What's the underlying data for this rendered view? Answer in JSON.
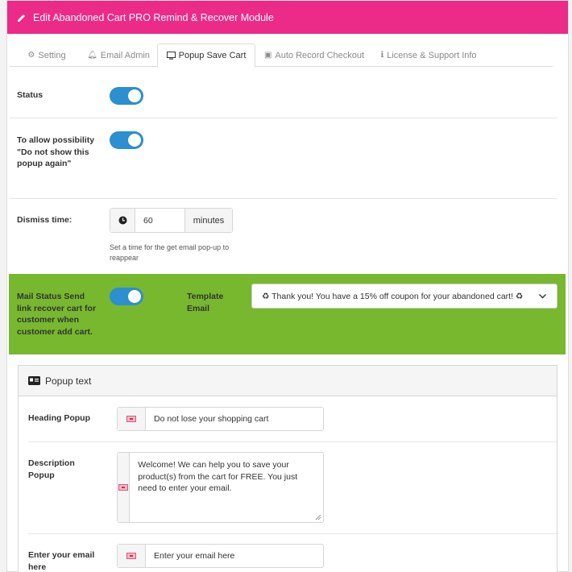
{
  "header": {
    "title": "Edit Abandoned Cart PRO Remind & Recover Module",
    "icon": "pencil-icon"
  },
  "tabs": [
    {
      "label": "Setting",
      "icon": "gear-icon"
    },
    {
      "label": "Email Admin",
      "icon": "bell-icon"
    },
    {
      "label": "Popup Save Cart",
      "icon": "monitor-icon"
    },
    {
      "label": "Auto Record Checkout",
      "icon": "save-icon"
    },
    {
      "label": "License & Support Info",
      "icon": "info-icon"
    }
  ],
  "active_tab": "Popup Save Cart",
  "form": {
    "status_label": "Status",
    "status_on": true,
    "allow_label": "To allow possibility \"Do not show this popup again\"",
    "allow_on": true,
    "dismiss_label": "Dismiss time:",
    "dismiss_value": "60",
    "dismiss_unit": "minutes",
    "dismiss_help": "Set a time for the get email pop-up to reappear",
    "mail_status_label": "Mail Status Send link recover cart for customer when customer add cart.",
    "mail_status_on": true,
    "template_label": "Template Email",
    "template_value": "♻ Thank you! You have a 15% off coupon for your abandoned cart! ♻"
  },
  "popup_text": {
    "title": "Popup text",
    "heading_label": "Heading Popup",
    "heading_value": "Do not lose your shopping cart",
    "description_label": "Description Popup",
    "description_value": "Welcome! We can help you to save your product(s) from the cart for FREE. You just need to enter your email.",
    "email_label": "Enter your email here",
    "email_value": "Enter your email here"
  },
  "colors": {
    "header": "#ec2a87",
    "toggle": "#2b8fd0",
    "mail_status_bg": "#77b82f"
  }
}
